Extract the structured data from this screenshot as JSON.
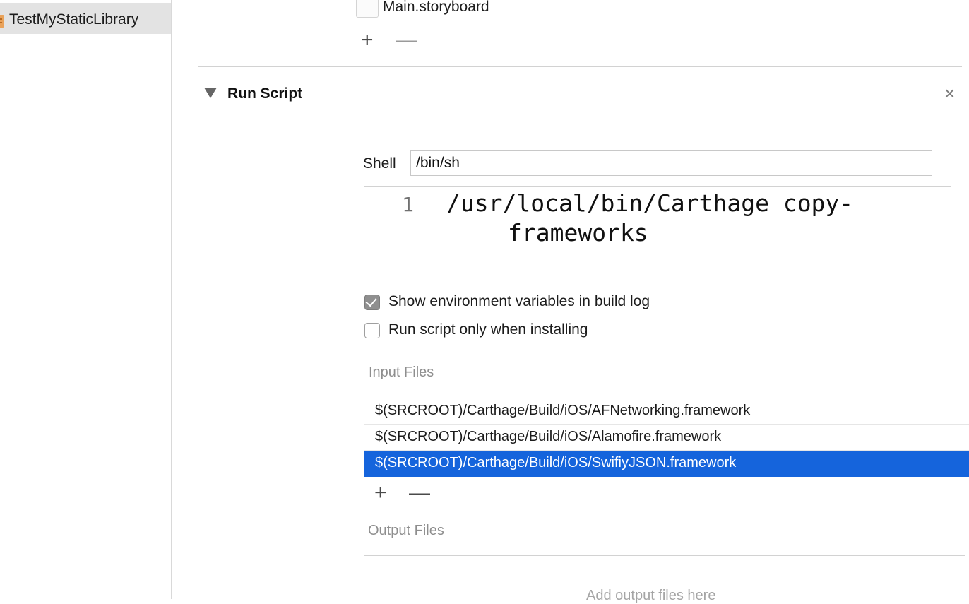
{
  "sidebar": {
    "target_label": "TestMyStaticLibrary"
  },
  "resources": {
    "file_label": "Main.storyboard",
    "add_label": "+",
    "remove_label": "—"
  },
  "run_script": {
    "title": "Run Script",
    "close_label": "×",
    "shell_label": "Shell",
    "shell_value": "/bin/sh",
    "line_number": "1",
    "script_line_1": "/usr/local/bin/Carthage copy-",
    "script_line_2": "frameworks",
    "options": [
      {
        "label": "Show environment variables in build log",
        "checked": true
      },
      {
        "label": "Run script only when installing",
        "checked": false
      }
    ],
    "input_files_label": "Input Files",
    "input_files": [
      "$(SRCROOT)/Carthage/Build/iOS/AFNetworking.framework",
      "$(SRCROOT)/Carthage/Build/iOS/Alamofire.framework",
      "$(SRCROOT)/Carthage/Build/iOS/SwifiyJSON.framework"
    ],
    "selected_input_index": 2,
    "add_label": "+",
    "remove_label": "—",
    "output_files_label": "Output Files",
    "output_placeholder": "Add output files here"
  },
  "colors": {
    "selection": "#1564dc",
    "sidebar_selected": "#e3e3e3"
  }
}
